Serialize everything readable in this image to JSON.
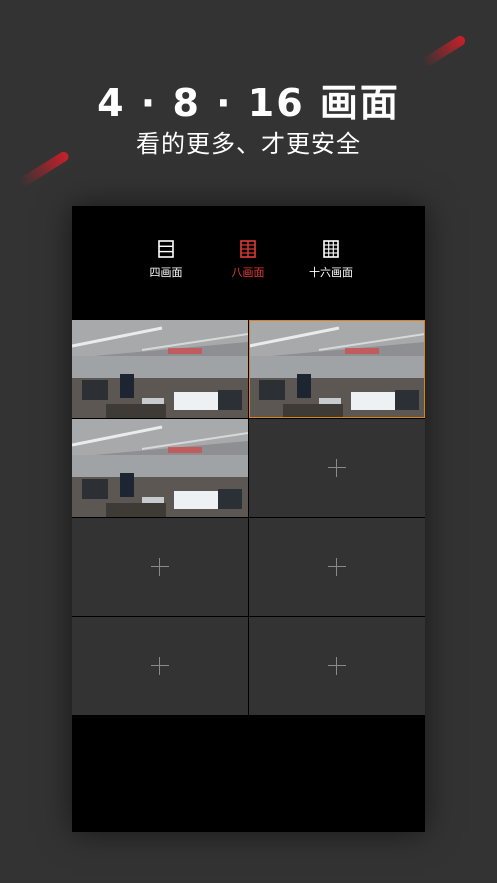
{
  "promo": {
    "headline": "4 · 8 · 16 画面",
    "subline": "看的更多、才更安全"
  },
  "modes": [
    {
      "label": "四画面",
      "icon": "four-split-icon",
      "active": false
    },
    {
      "label": "八画面",
      "icon": "eight-split-icon",
      "active": true
    },
    {
      "label": "十六画面",
      "icon": "sixteen-split-icon",
      "active": false
    }
  ],
  "colors": {
    "accent": "#e03a3a",
    "selected_outline": "#d9821f",
    "background": "#333333"
  },
  "grid": {
    "slots": [
      {
        "type": "feed",
        "selected": false
      },
      {
        "type": "feed",
        "selected": true
      },
      {
        "type": "feed",
        "selected": false
      },
      {
        "type": "empty",
        "icon": "plus-icon"
      },
      {
        "type": "empty",
        "icon": "plus-icon"
      },
      {
        "type": "empty",
        "icon": "plus-icon"
      },
      {
        "type": "empty",
        "icon": "plus-icon"
      },
      {
        "type": "empty",
        "icon": "plus-icon"
      }
    ]
  }
}
